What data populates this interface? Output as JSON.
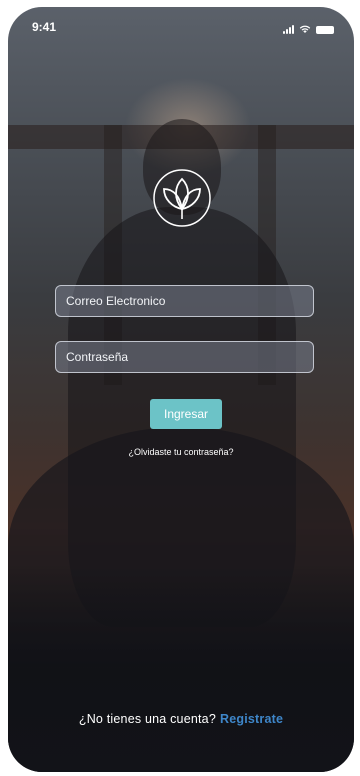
{
  "status_bar": {
    "time": "9:41",
    "icons": [
      "signal-icon",
      "wifi-icon",
      "battery-icon"
    ]
  },
  "logo": {
    "icon": "lotus-leaf-logo-icon"
  },
  "form": {
    "email_placeholder": "Correo Electronico",
    "password_placeholder": "Contraseña",
    "login_label": "Ingresar",
    "forgot_label": "¿Olvidaste tu contraseña?"
  },
  "footer": {
    "signup_prompt": "¿No tienes una cuenta?",
    "signup_link": "Registrate"
  },
  "colors": {
    "accent_button": "#6cc3c7",
    "link_blue": "#3e86c9",
    "text": "#ffffff"
  }
}
